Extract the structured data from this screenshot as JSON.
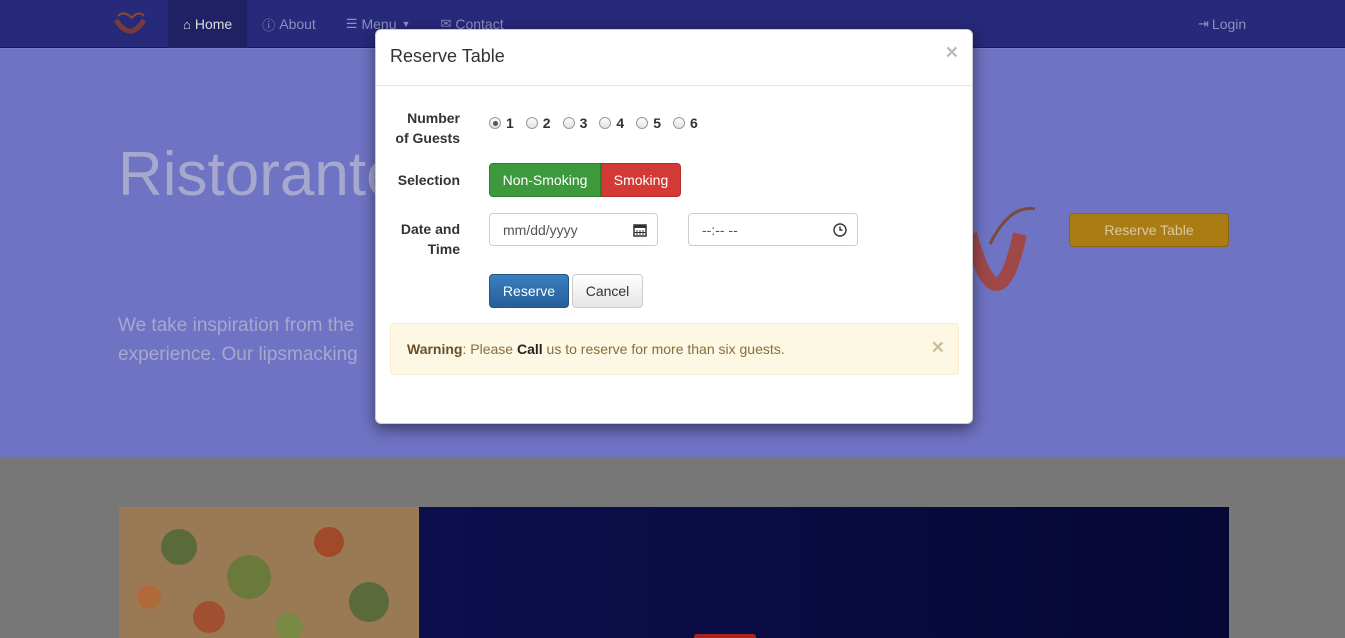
{
  "navbar": {
    "items": [
      {
        "label": "Home",
        "icon": "home-icon"
      },
      {
        "label": "About",
        "icon": "info-icon"
      },
      {
        "label": "Menu",
        "icon": "list-icon"
      },
      {
        "label": "Contact",
        "icon": "envelope-icon"
      }
    ],
    "login": "Login"
  },
  "hero": {
    "title": "Ristorante",
    "text": "We take inspiration from the experience. Our lipsmacking",
    "reserve_btn": "Reserve Table"
  },
  "modal": {
    "title": "Reserve Table",
    "guests_label_1": "Number",
    "guests_label_2": "of Guests",
    "guest_options": [
      "1",
      "2",
      "3",
      "4",
      "5",
      "6"
    ],
    "guest_selected": "1",
    "selection_label": "Selection",
    "non_smoking": "Non-Smoking",
    "smoking": "Smoking",
    "datetime_label_1": "Date and",
    "datetime_label_2": "Time",
    "date_placeholder": "mm/dd/yyyy",
    "time_placeholder": "--:-- --",
    "reserve": "Reserve",
    "cancel": "Cancel",
    "alert": {
      "strong": "Warning",
      "part1": ": Please ",
      "call": "Call",
      "part2": " us to reserve for more than six guests."
    }
  },
  "colors": {
    "navbar": "#27297a",
    "jumbotron": "#6f73c4",
    "success": "#3c9a3c",
    "danger": "#d43a35",
    "primary": "#2e6da4",
    "warning_bg": "#fcf8e3"
  }
}
